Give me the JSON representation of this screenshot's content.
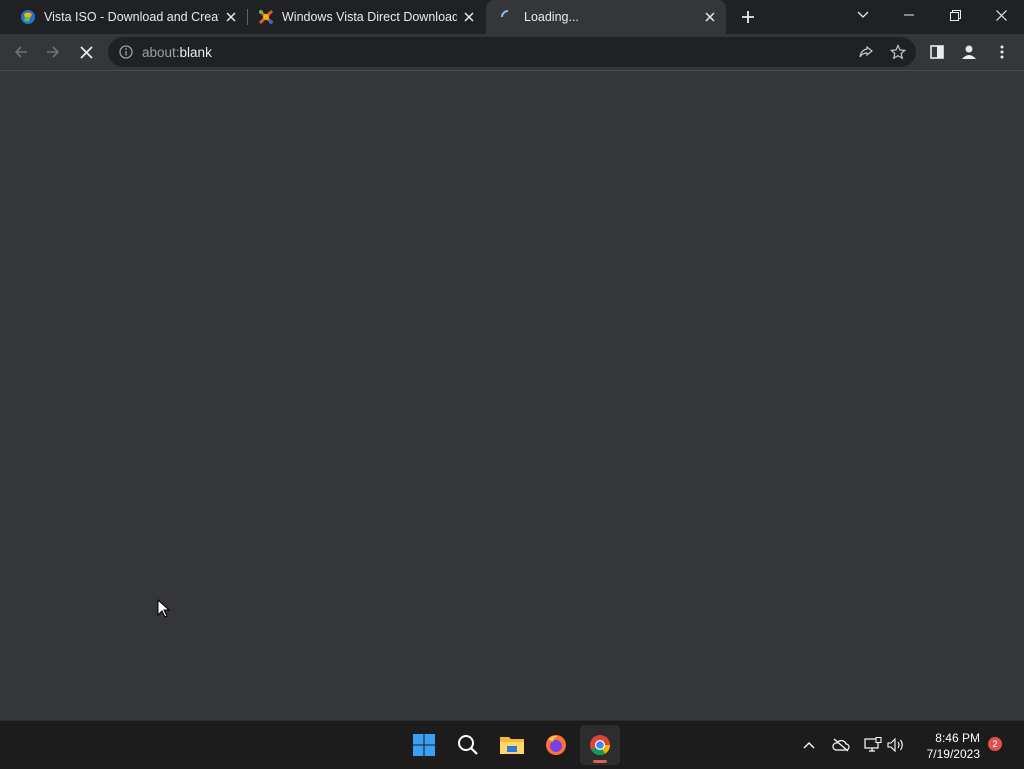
{
  "browser": {
    "tabs": [
      {
        "title": "Vista ISO - Download and Create",
        "favicon": "vista-logo-icon"
      },
      {
        "title": "Windows Vista Direct Download",
        "favicon": "vista-logo-icon"
      },
      {
        "title": "Loading...",
        "favicon": "loading-spinner-icon"
      }
    ],
    "address": {
      "prefix": "about:",
      "rest": "blank"
    }
  },
  "taskbar": {
    "time": "8:46 PM",
    "date": "7/19/2023",
    "notification_count": "2"
  },
  "colors": {
    "titlebar": "#202124",
    "toolbar": "#35363a",
    "content": "#35363a",
    "taskbar": "#1c1c1c",
    "accent": "#1a73e8"
  }
}
